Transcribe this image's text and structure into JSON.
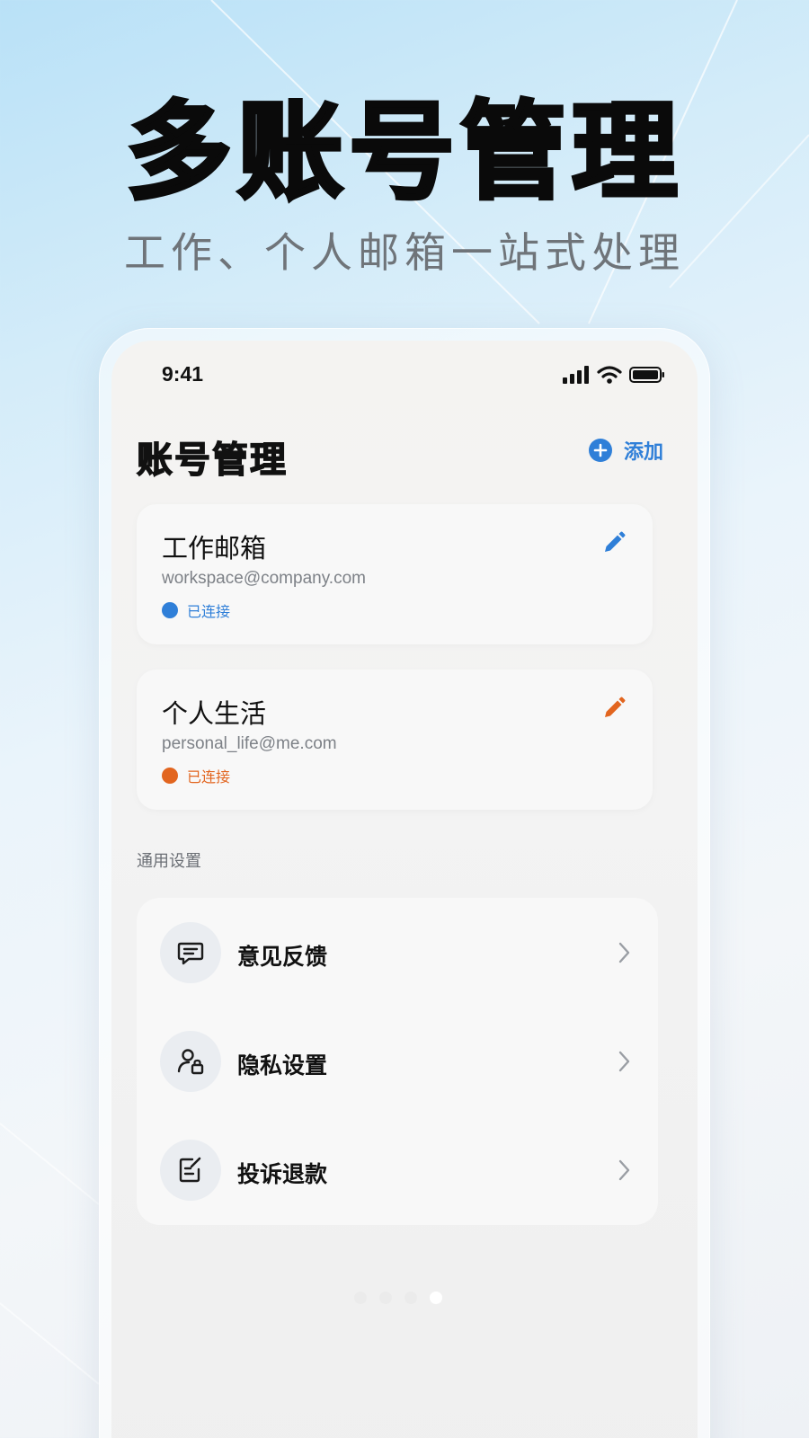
{
  "promo": {
    "headline": "多账号管理",
    "subheadline": "工作、个人邮箱一站式处理"
  },
  "status_bar": {
    "time": "9:41",
    "icons": [
      "signal-icon",
      "wifi-icon",
      "battery-icon"
    ]
  },
  "header": {
    "title": "账号管理",
    "add_label": "添加",
    "add_icon": "plus-circle-icon",
    "accent": "#2f7fd8"
  },
  "accounts": [
    {
      "name": "工作邮箱",
      "email": "workspace@company.com",
      "status": "已连接",
      "color": "#2f7fd8",
      "edit_icon": "pencil-icon"
    },
    {
      "name": "个人生活",
      "email": "personal_life@me.com",
      "status": "已连接",
      "color": "#e2651f",
      "edit_icon": "pencil-icon"
    }
  ],
  "settings": {
    "section_label": "通用设置",
    "items": [
      {
        "label": "意见反馈",
        "icon": "message-icon"
      },
      {
        "label": "隐私设置",
        "icon": "user-lock-icon"
      },
      {
        "label": "投诉退款",
        "icon": "edit-document-icon"
      }
    ]
  },
  "pagination": {
    "pages": 4,
    "current": 4
  }
}
